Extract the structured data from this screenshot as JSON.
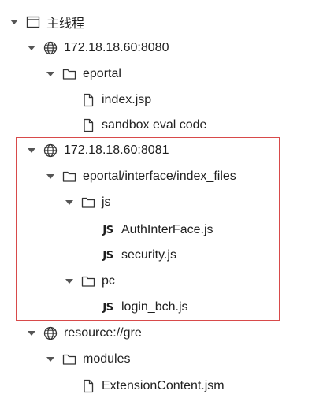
{
  "tree": {
    "root": {
      "label": "主线程",
      "icon": "window-icon",
      "expanded": true
    },
    "host1": {
      "label": "172.18.18.60:8080",
      "icon": "globe-icon",
      "expanded": true
    },
    "host1_folder": {
      "label": "eportal",
      "icon": "folder-icon",
      "expanded": true
    },
    "host1_file1": {
      "label": "index.jsp",
      "icon": "file-icon"
    },
    "host1_file2": {
      "label": "sandbox eval code",
      "icon": "file-icon"
    },
    "host2": {
      "label": "172.18.18.60:8081",
      "icon": "globe-icon",
      "expanded": true
    },
    "host2_folder": {
      "label": "eportal/interface/index_files",
      "icon": "folder-icon",
      "expanded": true
    },
    "js_folder": {
      "label": "js",
      "icon": "folder-icon",
      "expanded": true
    },
    "js_file1": {
      "label": "AuthInterFace.js",
      "badge": "JS"
    },
    "js_file2": {
      "label": "security.js",
      "badge": "JS"
    },
    "pc_folder": {
      "label": "pc",
      "icon": "folder-icon",
      "expanded": true
    },
    "pc_file1": {
      "label": "login_bch.js",
      "badge": "JS"
    },
    "host3": {
      "label": "resource://gre",
      "icon": "globe-icon",
      "expanded": true
    },
    "host3_folder": {
      "label": "modules",
      "icon": "folder-icon",
      "expanded": true
    },
    "host3_file1": {
      "label": "ExtensionContent.jsm",
      "icon": "file-icon"
    }
  },
  "colors": {
    "highlight_border": "#d84a4a",
    "twisty": "#555555",
    "text": "#1f1f1f"
  }
}
